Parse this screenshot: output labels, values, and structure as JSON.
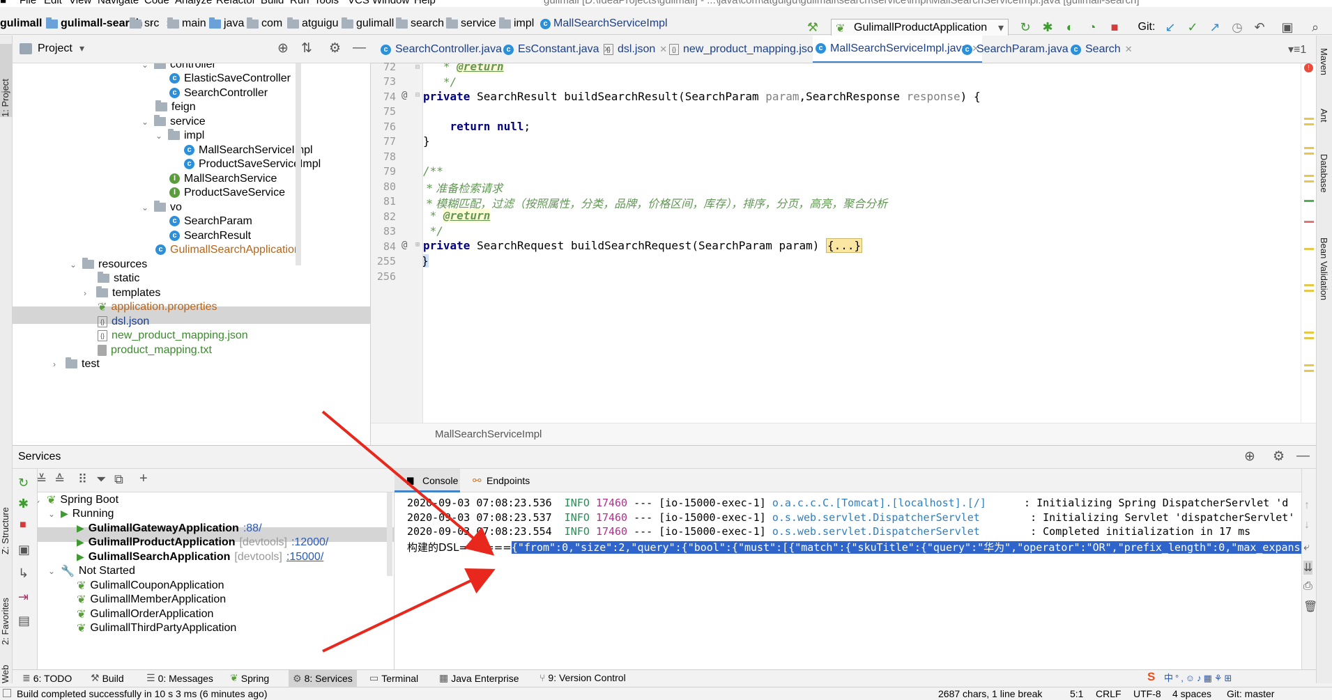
{
  "menubar": {
    "items": [
      "File",
      "Edit",
      "View",
      "Navigate",
      "Code",
      "Analyze",
      "Refactor",
      "Build",
      "Run",
      "Tools",
      "VCS",
      "Window",
      "Help"
    ],
    "title": "gulimall [D:\\IdeaProjects\\gulimall] - ...\\java\\com\\atguigu\\gulimall\\search\\service\\impl\\MallSearchServiceImpl.java [gulimall-search]"
  },
  "breadcrumb": [
    "gulimall",
    "gulimall-search",
    "src",
    "main",
    "java",
    "com",
    "atguigu",
    "gulimall",
    "search",
    "service",
    "impl",
    "MallSearchServiceImpl"
  ],
  "toolbar": {
    "run_config": "GulimallProductApplication",
    "git_label": "Git:"
  },
  "project": {
    "title": "Project",
    "tree": [
      {
        "label": "controller",
        "type": "folder"
      },
      {
        "label": "ElasticSaveController",
        "type": "class"
      },
      {
        "label": "SearchController",
        "type": "class"
      },
      {
        "label": "feign",
        "type": "folder"
      },
      {
        "label": "service",
        "type": "folder"
      },
      {
        "label": "impl",
        "type": "folder"
      },
      {
        "label": "MallSearchServiceImpl",
        "type": "class"
      },
      {
        "label": "ProductSaveServiceImpl",
        "type": "class"
      },
      {
        "label": "MallSearchService",
        "type": "interface"
      },
      {
        "label": "ProductSaveService",
        "type": "interface"
      },
      {
        "label": "vo",
        "type": "folder"
      },
      {
        "label": "SearchParam",
        "type": "class"
      },
      {
        "label": "SearchResult",
        "type": "class"
      },
      {
        "label": "GulimallSearchApplication",
        "type": "app"
      },
      {
        "label": "resources",
        "type": "folder"
      },
      {
        "label": "static",
        "type": "folder"
      },
      {
        "label": "templates",
        "type": "folder"
      },
      {
        "label": "application.properties",
        "type": "props"
      },
      {
        "label": "dsl.json",
        "type": "json"
      },
      {
        "label": "new_product_mapping.json",
        "type": "json"
      },
      {
        "label": "product_mapping.txt",
        "type": "txt"
      },
      {
        "label": "test",
        "type": "folder"
      }
    ]
  },
  "editor": {
    "tabs": [
      "SearchController.java",
      "EsConstant.java",
      "dsl.json",
      "new_product_mapping.json",
      "MallSearchServiceImpl.java",
      "SearchParam.java",
      "Search"
    ],
    "active_tab": "MallSearchServiceImpl.java",
    "line_numbers": [
      "72",
      "73",
      "74",
      "75",
      "76",
      "77",
      "78",
      "79",
      "80",
      "81",
      "82",
      "83",
      "84",
      "255",
      "256"
    ],
    "code": {
      "l72_tag": "@return",
      "l73": "*/",
      "l74_kw": "private",
      "l74_sig": "SearchResult buildSearchResult(SearchParam",
      "l74_p1": "param",
      "l74_mid": ",SearchResponse",
      "l74_p2": "response",
      "l74_end": ") {",
      "l76_kw": "return",
      "l76_val": "null",
      "l76_end": ";",
      "l77": "}",
      "l79": "/**",
      "l80": "* 准备检索请求",
      "l81": "* 模糊匹配，过滤（按照属性，分类，品牌，价格区间，库存），排序，分页，高亮，聚合分析",
      "l82_tag": "@return",
      "l83": "*/",
      "l84_kw": "private",
      "l84_sig": "SearchRequest buildSearchRequest(SearchParam param)",
      "l84_fold": "{...}",
      "l255": "}"
    },
    "breadcrumb": "MallSearchServiceImpl"
  },
  "services": {
    "title": "Services",
    "tree": {
      "spring_boot": "Spring Boot",
      "running": "Running",
      "apps_running": [
        {
          "name": "GulimallGatewayApplication",
          "devtools": "",
          "port": ":88/"
        },
        {
          "name": "GulimallProductApplication",
          "devtools": "[devtools]",
          "port": ":12000/"
        },
        {
          "name": "GulimallSearchApplication",
          "devtools": "[devtools]",
          "port": ":15000/"
        }
      ],
      "not_started": "Not Started",
      "apps_stopped": [
        "GulimallCouponApplication",
        "GulimallMemberApplication",
        "GulimallOrderApplication",
        "GulimallThirdPartyApplication"
      ]
    },
    "console_tabs": [
      "Console",
      "Endpoints"
    ],
    "log": [
      {
        "time": "2020-09-03 07:08:23.536",
        "level": "INFO",
        "pid": "17460",
        "sep": "---",
        "thread": "[io-15000-exec-1]",
        "logger": "o.a.c.c.C.[Tomcat].[localhost].[/]",
        "msg": ": Initializing Spring DispatcherServlet 'd"
      },
      {
        "time": "2020-09-03 07:08:23.537",
        "level": "INFO",
        "pid": "17460",
        "sep": "---",
        "thread": "[io-15000-exec-1]",
        "logger": "o.s.web.servlet.DispatcherServlet",
        "msg": ": Initializing Servlet 'dispatcherServlet'"
      },
      {
        "time": "2020-09-03 07:08:23.554",
        "level": "INFO",
        "pid": "17460",
        "sep": "---",
        "thread": "[io-15000-exec-1]",
        "logger": "o.s.web.servlet.DispatcherServlet",
        "msg": ": Completed initialization in 17 ms"
      }
    ],
    "dsl_prefix": "构建的DSL======",
    "dsl_json": "{\"from\":0,\"size\":2,\"query\":{\"bool\":{\"must\":[{\"match\":{\"skuTitle\":{\"query\":\"华为\",\"operator\":\"OR\",\"prefix_length\":0,\"max_expansi"
  },
  "bottom_tools": [
    "6: TODO",
    "Build",
    "0: Messages",
    "Spring",
    "8: Services",
    "Terminal",
    "Java Enterprise",
    "9: Version Control"
  ],
  "side_tabs_left": [
    "1: Project",
    "Z: Structure",
    "2: Favorites",
    "Web"
  ],
  "side_tabs_right": [
    "Maven",
    "Ant",
    "Database",
    "Bean Validation"
  ],
  "status": {
    "message": "Build completed successfully in 10 s 3 ms (6 minutes ago)",
    "chars": "2687 chars, 1 line break",
    "position": "5:1",
    "line_sep": "CRLF",
    "encoding": "UTF-8",
    "indent": "4 spaces",
    "vcs": "Git: master"
  },
  "colors": {
    "accent": "#4083c9",
    "selection": "#2f65ca",
    "annotation_arrow": "#e8281c"
  }
}
